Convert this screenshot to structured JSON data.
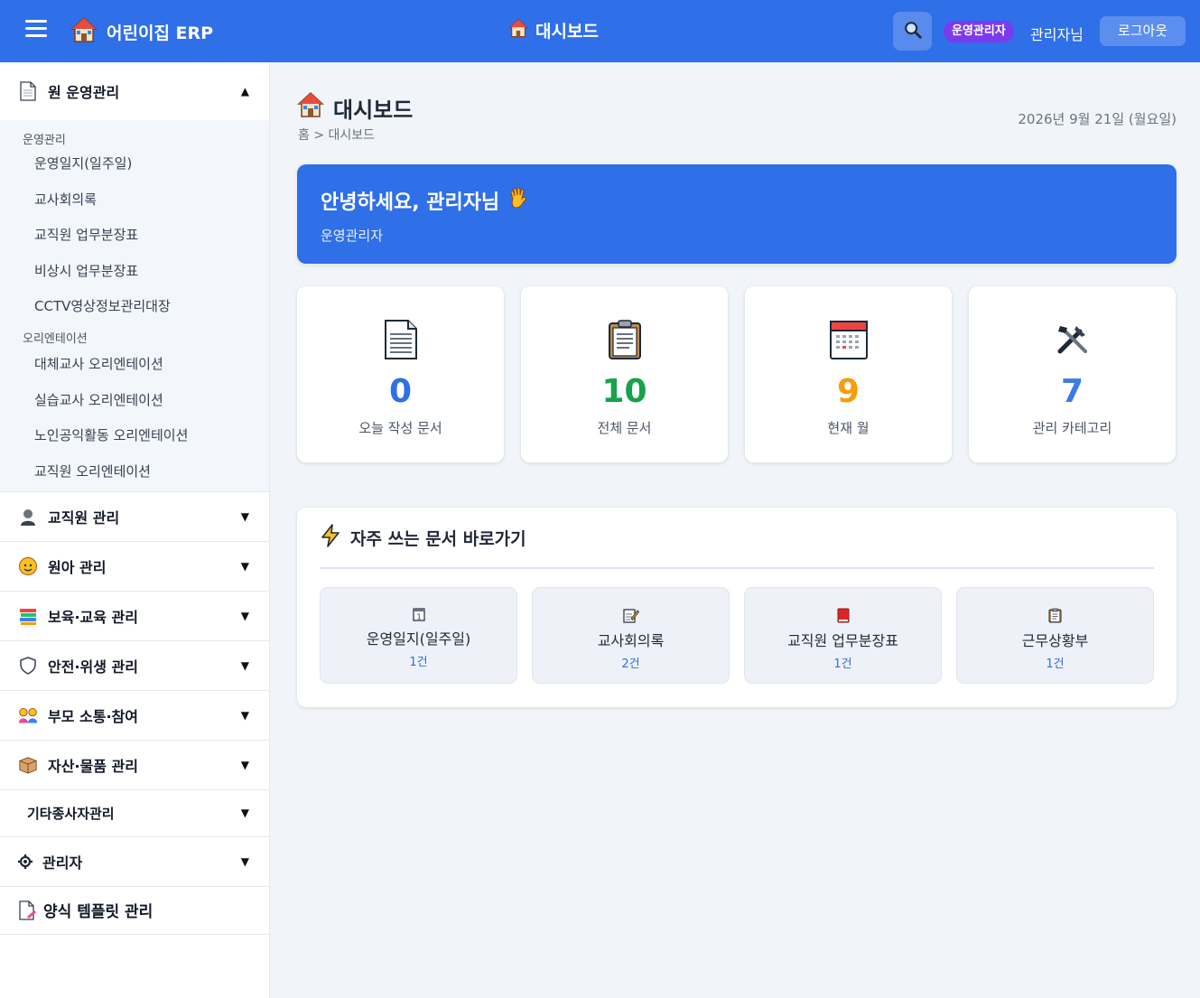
{
  "header": {
    "brand": "어린이집 ERP",
    "title": "대시보드",
    "role_badge": "운영관리자",
    "user_name": "관리자님",
    "logout": "로그아웃"
  },
  "sidebar": {
    "open_section": {
      "label": "원 운영관리",
      "groups": [
        {
          "title": "운영관리",
          "items": [
            "운영일지(일주일)",
            "교사회의록",
            "교직원 업무분장표",
            "비상시 업무분장표",
            "CCTV영상정보관리대장"
          ]
        },
        {
          "title": "오리엔테이션",
          "items": [
            "대체교사 오리엔테이션",
            "실습교사 오리엔테이션",
            "노인공익활동 오리엔테이션",
            "교직원 오리엔테이션"
          ]
        }
      ]
    },
    "sections": [
      {
        "label": "교직원 관리",
        "icon": "teacher-icon"
      },
      {
        "label": "원아 관리",
        "icon": "child-icon"
      },
      {
        "label": "보육·교육 관리",
        "icon": "books-icon"
      },
      {
        "label": "안전·위생 관리",
        "icon": "shield-icon"
      },
      {
        "label": "부모 소통·참여",
        "icon": "family-icon"
      },
      {
        "label": "자산·물품 관리",
        "icon": "box-icon"
      },
      {
        "label": "기타종사자관리",
        "icon": ""
      },
      {
        "label": "관리자",
        "icon": "gear-icon"
      },
      {
        "label": "양식 템플릿 관리",
        "icon": "template-icon"
      }
    ]
  },
  "main": {
    "title": "대시보드",
    "breadcrumb": "홈 > 대시보드",
    "date": "2026년 9월 21일 (월요일)",
    "welcome": {
      "greeting": "안녕하세요, 관리자님",
      "role": "운영관리자"
    },
    "stats": [
      {
        "value": "0",
        "label": "오늘 작성 문서",
        "color": "#2f6fe8",
        "icon": "document-icon"
      },
      {
        "value": "10",
        "label": "전체 문서",
        "color": "#16a34a",
        "icon": "clipboard-icon"
      },
      {
        "value": "9",
        "label": "현재 월",
        "color": "#f59e0b",
        "icon": "calendar-icon"
      },
      {
        "value": "7",
        "label": "관리 카테고리",
        "color": "#2f6fe8",
        "icon": "tools-icon"
      }
    ],
    "quick": {
      "title": "자주 쓰는 문서 바로가기",
      "items": [
        {
          "name": "운영일지(일주일)",
          "count": "1건",
          "icon": "calendar-one-icon"
        },
        {
          "name": "교사회의록",
          "count": "2건",
          "icon": "memo-icon"
        },
        {
          "name": "교직원 업무분장표",
          "count": "1건",
          "icon": "red-book-icon"
        },
        {
          "name": "근무상황부",
          "count": "1건",
          "icon": "clipboard-icon"
        }
      ]
    }
  }
}
